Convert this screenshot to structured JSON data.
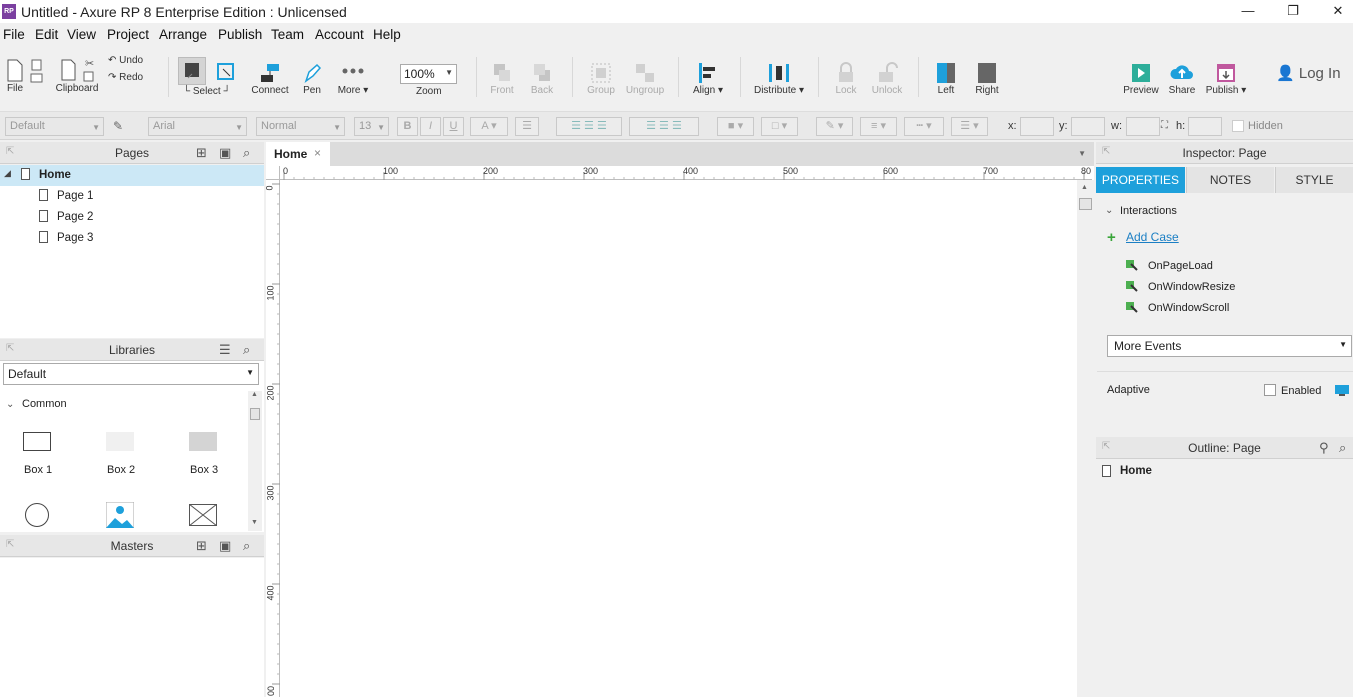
{
  "window": {
    "title": "Untitled - Axure RP 8 Enterprise Edition : Unlicensed",
    "icon_text": "RP",
    "minimize": "—",
    "maximize": "❐",
    "close": "✕"
  },
  "menu": [
    "File",
    "Edit",
    "View",
    "Project",
    "Arrange",
    "Publish",
    "Team",
    "Account",
    "Help"
  ],
  "toolbar": {
    "file": "File",
    "clipboard": "Clipboard",
    "undo": "Undo",
    "redo": "Redo",
    "select": "Select",
    "connect": "Connect",
    "pen": "Pen",
    "more": "More ▾",
    "zoom_value": "100%",
    "zoom": "Zoom",
    "front": "Front",
    "back": "Back",
    "group": "Group",
    "ungroup": "Ungroup",
    "align": "Align ▾",
    "distribute": "Distribute ▾",
    "lock": "Lock",
    "unlock": "Unlock",
    "left": "Left",
    "right": "Right",
    "preview": "Preview",
    "share": "Share",
    "publish": "Publish ▾",
    "login": "Log In"
  },
  "format": {
    "style": "Default",
    "font": "Arial",
    "weight": "Normal",
    "size": "13",
    "x": "x:",
    "y": "y:",
    "w": "w:",
    "h": "h:",
    "hidden": "Hidden"
  },
  "pages": {
    "title": "Pages",
    "items": [
      "Home",
      "Page 1",
      "Page 2",
      "Page 3"
    ]
  },
  "libraries": {
    "title": "Libraries",
    "selected": "Default",
    "section": "Common",
    "items": [
      "Box 1",
      "Box 2",
      "Box 3"
    ]
  },
  "masters": {
    "title": "Masters"
  },
  "canvas": {
    "tab": "Home",
    "ruler_h": [
      "0",
      "100",
      "200",
      "300",
      "400",
      "500",
      "600",
      "700",
      "80"
    ],
    "ruler_v": [
      "0",
      "100",
      "200",
      "300",
      "400",
      "00"
    ]
  },
  "inspector": {
    "title": "Inspector: Page",
    "tabs": [
      "PROPERTIES",
      "NOTES",
      "STYLE"
    ],
    "interactions": "Interactions",
    "add_case": "Add Case",
    "events": [
      "OnPageLoad",
      "OnWindowResize",
      "OnWindowScroll"
    ],
    "more_events": "More Events",
    "adaptive": "Adaptive",
    "enabled": "Enabled"
  },
  "outline": {
    "title": "Outline: Page",
    "item": "Home"
  },
  "colors": {
    "accent": "#1ea0db",
    "selection": "#cce8f6"
  }
}
